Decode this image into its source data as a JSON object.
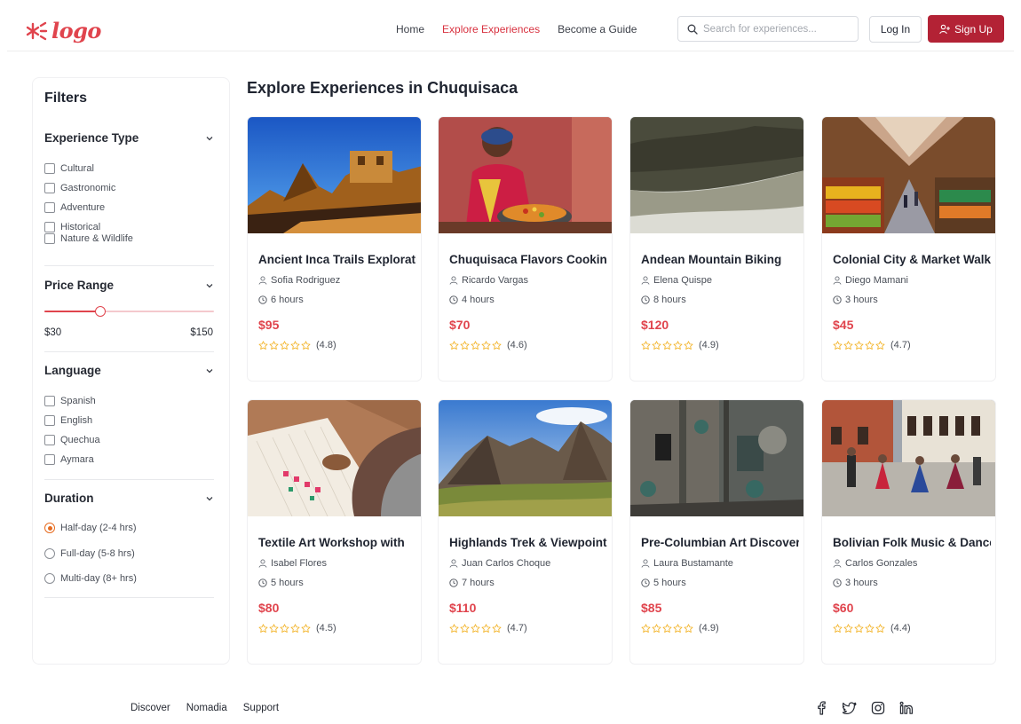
{
  "header": {
    "logo_text": "logo",
    "nav": [
      {
        "label": "Home",
        "active": false
      },
      {
        "label": "Explore Experiences",
        "active": true
      },
      {
        "label": "Become a Guide",
        "active": false
      }
    ],
    "search_placeholder": "Search for experiences...",
    "login_label": "Log In",
    "signup_label": "Sign Up"
  },
  "colors": {
    "brand": "#e0444d",
    "signup_bg": "#b32235",
    "radio_accent": "#e66b1f",
    "star": "#f2b01e"
  },
  "sidebar": {
    "title": "Filters",
    "experience_type": {
      "label": "Experience Type",
      "options": [
        "Cultural",
        "Gastronomic",
        "Adventure",
        "Historical",
        "Nature & Wildlife"
      ]
    },
    "price_range": {
      "label": "Price Range",
      "min_label": "$30",
      "max_label": "$150",
      "slider_value_fraction": 0.33
    },
    "language": {
      "label": "Language",
      "options": [
        "Spanish",
        "English",
        "Quechua",
        "Aymara"
      ]
    },
    "duration": {
      "label": "Duration",
      "options": [
        "Half-day (2-4 hrs)",
        "Full-day (5-8 hrs)",
        "Multi-day (8+ hrs)"
      ],
      "selected_index": 0
    }
  },
  "main": {
    "title": "Explore Experiences in Chuquisaca",
    "cards": [
      {
        "title": "Ancient Inca Trails Exploration",
        "guide": "Sofia Rodriguez",
        "duration": "6 hours",
        "price": "$95",
        "rating": "(4.8)",
        "image": "inca-ruins-photo"
      },
      {
        "title": "Chuquisaca Flavors Cooking",
        "guide": "Ricardo Vargas",
        "duration": "4 hours",
        "price": "$70",
        "rating": "(4.6)",
        "image": "cooking-photo"
      },
      {
        "title": "Andean Mountain Biking",
        "guide": "Elena Quispe",
        "duration": "8 hours",
        "price": "$120",
        "rating": "(4.9)",
        "image": "mountain-valley-photo"
      },
      {
        "title": "Colonial City & Market Walk",
        "guide": "Diego Mamani",
        "duration": "3 hours",
        "price": "$45",
        "rating": "(4.7)",
        "image": "market-photo"
      },
      {
        "title": "Textile Art Workshop with",
        "guide": "Isabel Flores",
        "duration": "5 hours",
        "price": "$80",
        "rating": "(4.5)",
        "image": "weaving-photo"
      },
      {
        "title": "Highlands Trek & Viewpoints",
        "guide": "Juan Carlos Choque",
        "duration": "7 hours",
        "price": "$110",
        "rating": "(4.7)",
        "image": "highlands-photo"
      },
      {
        "title": "Pre-Columbian Art Discovery",
        "guide": "Laura Bustamante",
        "duration": "5 hours",
        "price": "$85",
        "rating": "(4.9)",
        "image": "stone-art-photo"
      },
      {
        "title": "Bolivian Folk Music & Dance",
        "guide": "Carlos Gonzales",
        "duration": "3 hours",
        "price": "$60",
        "rating": "(4.4)",
        "image": "folk-dance-photo"
      }
    ]
  },
  "footer": {
    "links": [
      "Discover",
      "Nomadia",
      "Support"
    ],
    "social_icons": [
      "facebook-icon",
      "twitter-icon",
      "instagram-icon",
      "linkedin-icon"
    ]
  }
}
